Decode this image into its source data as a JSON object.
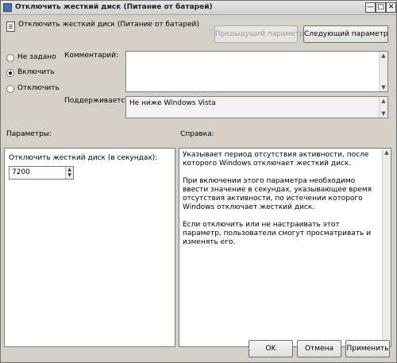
{
  "window": {
    "title": "Отключить жесткий диск (Питание от батарей)",
    "minimize_label": "—",
    "maximize_label": "□",
    "close_label": "✕"
  },
  "header": {
    "policy_title": "Отключить жесткий диск (Питание от батарей)",
    "prev_button": "Предыдущий параметр",
    "next_button": "Следующий параметр"
  },
  "state": {
    "options": [
      {
        "label": "Не задано",
        "checked": false
      },
      {
        "label": "Включить",
        "checked": true
      },
      {
        "label": "Отключить",
        "checked": false
      }
    ]
  },
  "comment": {
    "label": "Комментарий:",
    "value": ""
  },
  "supported": {
    "label": "Поддерживается:",
    "value": "Не ниже Windows Vista"
  },
  "options_section": {
    "label": "Параметры:",
    "field_label": "Отключить жесткий диск (в секундах):",
    "field_value": "7200"
  },
  "help_section": {
    "label": "Справка:",
    "paragraphs": [
      "Указывает период отсутствия активности, после которого Windows отключает жесткий диск.",
      "При включении этого параметра необходимо ввести значение в секундах, указывающее время отсутствия активности, по истечении которого Windows отключает жесткий диск.",
      "Если отключить или не настраивать этот параметр, пользователи смогут просматривать и изменять его."
    ]
  },
  "footer": {
    "ok": "OK",
    "cancel": "Отмена",
    "apply": "Применить"
  }
}
